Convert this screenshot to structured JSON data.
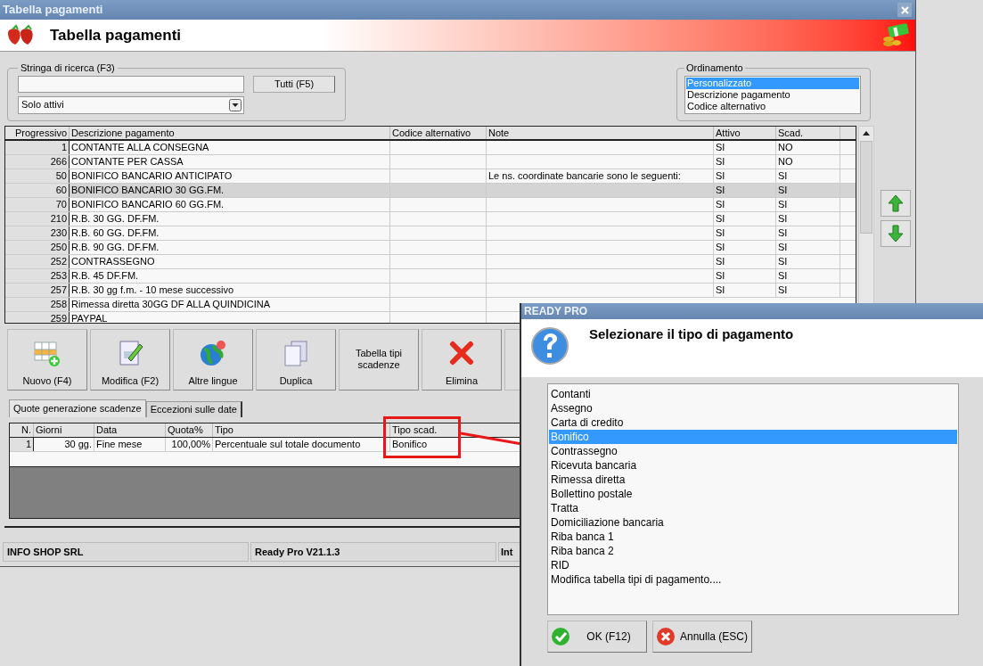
{
  "window": {
    "title": "Tabella pagamenti"
  },
  "header": {
    "title": "Tabella pagamenti"
  },
  "search": {
    "label": "Stringa di ricerca (F3)",
    "button": "Tutti (F5)",
    "filter": "Solo attivi"
  },
  "sort": {
    "label": "Ordinamento",
    "options": [
      {
        "label": "Personalizzato",
        "selected": true
      },
      {
        "label": "Descrizione pagamento",
        "selected": false
      },
      {
        "label": "Codice alternativo",
        "selected": false
      }
    ]
  },
  "table": {
    "columns": [
      "Progressivo",
      "Descrizione pagamento",
      "Codice alternativo",
      "Note",
      "Attivo",
      "Scad."
    ],
    "rows": [
      {
        "progressivo": "1",
        "descrizione": "CONTANTE ALLA CONSEGNA",
        "attivo": "SI",
        "scad": "NO",
        "selected": false
      },
      {
        "progressivo": "266",
        "descrizione": "CONTANTE PER CASSA",
        "attivo": "SI",
        "scad": "NO",
        "selected": false
      },
      {
        "progressivo": "50",
        "descrizione": "BONIFICO BANCARIO ANTICIPATO",
        "note": "Le ns. coordinate bancarie sono le seguenti:",
        "attivo": "SI",
        "scad": "SI",
        "selected": false
      },
      {
        "progressivo": "60",
        "descrizione": "BONIFICO BANCARIO 30 GG.FM.",
        "attivo": "SI",
        "scad": "SI",
        "selected": true
      },
      {
        "progressivo": "70",
        "descrizione": "BONIFICO BANCARIO 60 GG.FM.",
        "attivo": "SI",
        "scad": "SI",
        "selected": false
      },
      {
        "progressivo": "210",
        "descrizione": "R.B. 30 GG. DF.FM.",
        "attivo": "SI",
        "scad": "SI",
        "selected": false
      },
      {
        "progressivo": "230",
        "descrizione": "R.B. 60 GG. DF.FM.",
        "attivo": "SI",
        "scad": "SI",
        "selected": false
      },
      {
        "progressivo": "250",
        "descrizione": "R.B. 90 GG. DF.FM.",
        "attivo": "SI",
        "scad": "SI",
        "selected": false
      },
      {
        "progressivo": "252",
        "descrizione": "CONTRASSEGNO",
        "attivo": "SI",
        "scad": "SI",
        "selected": false
      },
      {
        "progressivo": "253",
        "descrizione": "R.B. 45 DF.FM.",
        "attivo": "SI",
        "scad": "SI",
        "selected": false
      },
      {
        "progressivo": "257",
        "descrizione": "R.B. 30 gg f.m. - 10 mese successivo",
        "attivo": "SI",
        "scad": "SI",
        "selected": false
      },
      {
        "progressivo": "258",
        "descrizione": "Rimessa diretta 30GG DF ALLA QUINDICINA",
        "selected": false
      },
      {
        "progressivo": "259",
        "descrizione": "PAYPAL",
        "selected": false
      }
    ]
  },
  "toolbar": [
    {
      "label": "Nuovo (F4)",
      "kind": "new"
    },
    {
      "label": "Modifica (F2)",
      "kind": "edit"
    },
    {
      "label": "Altre lingue",
      "kind": "globe"
    },
    {
      "label": "Duplica",
      "kind": "copy"
    },
    {
      "label": "Tabella tipi scadenze",
      "kind": "text"
    },
    {
      "label": "Elimina",
      "kind": "delete"
    }
  ],
  "detail_tabs": [
    {
      "label": "Quote generazione scadenze",
      "selected": true
    },
    {
      "label": "Eccezioni sulle date",
      "selected": false
    }
  ],
  "quote_table": {
    "columns": [
      "N.",
      "Giorni",
      "Data",
      "Quota%",
      "Tipo",
      "Tipo scad."
    ],
    "rows": [
      {
        "cells": [
          "1",
          "30 gg.",
          "Fine mese",
          "100,00%",
          "Percentuale sul totale documento",
          "Bonifico"
        ]
      }
    ]
  },
  "status_bar": [
    "INFO SHOP SRL",
    "Ready Pro V21.1.3",
    "Int"
  ],
  "dialog": {
    "title": "READY PRO",
    "message": "Selezionare il tipo di pagamento",
    "options": [
      {
        "label": "Contanti",
        "selected": false
      },
      {
        "label": "Assegno",
        "selected": false
      },
      {
        "label": "Carta di credito",
        "selected": false
      },
      {
        "label": "Bonifico",
        "selected": true
      },
      {
        "label": "Contrassegno",
        "selected": false
      },
      {
        "label": "Ricevuta bancaria",
        "selected": false
      },
      {
        "label": "Rimessa diretta",
        "selected": false
      },
      {
        "label": "Bollettino postale",
        "selected": false
      },
      {
        "label": "Tratta",
        "selected": false
      },
      {
        "label": "Domiciliazione bancaria",
        "selected": false
      },
      {
        "label": "Riba banca 1",
        "selected": false
      },
      {
        "label": "Riba banca 2",
        "selected": false
      },
      {
        "label": "RID",
        "selected": false
      },
      {
        "label": "Modifica tabella tipi di pagamento....",
        "selected": false
      }
    ],
    "buttons": [
      {
        "label": "OK (F12)",
        "kind": "ok"
      },
      {
        "label": "Annulla (ESC)",
        "kind": "cancel"
      }
    ]
  }
}
